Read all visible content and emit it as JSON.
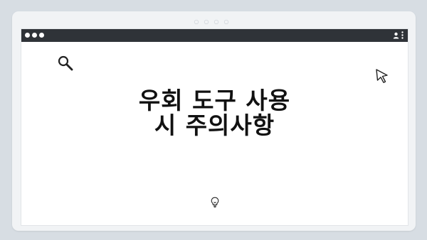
{
  "headline": {
    "line1": "우회 도구 사용",
    "line2": "시 주의사항"
  },
  "icons": {
    "traffic_lights": [
      "window-dot",
      "window-dot",
      "window-dot"
    ],
    "user": "user-icon",
    "menu": "kebab-menu-icon",
    "search": "search-icon",
    "cursor": "cursor-arrow-icon",
    "idea": "lightbulb-icon"
  },
  "colors": {
    "background": "#d7dde3",
    "frame": "#f1f3f5",
    "titlebar": "#2f3338",
    "text": "#111111"
  }
}
